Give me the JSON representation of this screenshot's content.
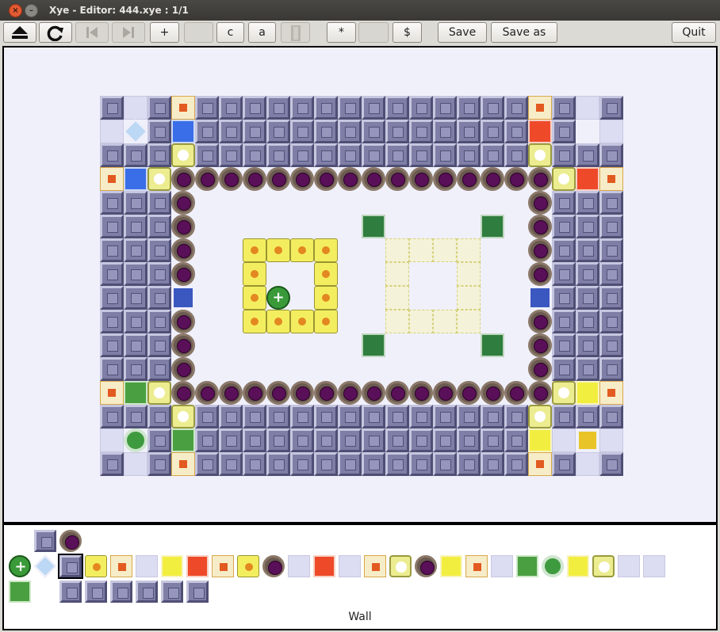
{
  "window": {
    "title": "Xye - Editor: 444.xye : 1/1"
  },
  "toolbar": {
    "plus_label": "+",
    "c_label": "c",
    "a_label": "a",
    "star_label": "*",
    "dollar_label": "$",
    "save_label": "Save",
    "save_as_label": "Save as",
    "quit_label": "Quit"
  },
  "palette": {
    "status_text": "Wall",
    "selected_tool": "wall"
  },
  "colors": {
    "wall": "#7e7ea6",
    "background": "#f0f0fb",
    "accent_yellow": "#f3ee60",
    "black_marked": "#5a1058"
  }
}
